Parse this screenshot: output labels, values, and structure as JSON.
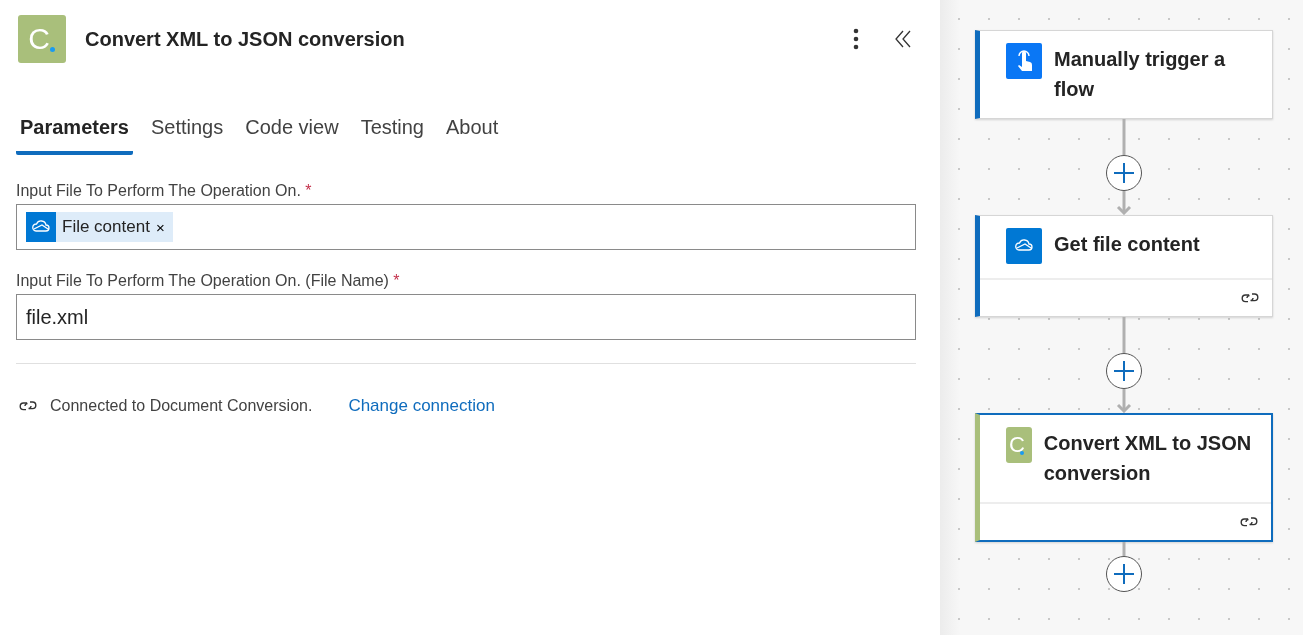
{
  "panel": {
    "logo_letter": "C",
    "title": "Convert XML to JSON conversion",
    "tabs": [
      {
        "label": "Parameters",
        "selected": true
      },
      {
        "label": "Settings",
        "selected": false
      },
      {
        "label": "Code view",
        "selected": false
      },
      {
        "label": "Testing",
        "selected": false
      },
      {
        "label": "About",
        "selected": false
      }
    ],
    "fields": [
      {
        "kind": "token",
        "label": "Input File To Perform The Operation On.",
        "required_mark": "*",
        "token": "File content",
        "token_remove": "×"
      },
      {
        "kind": "text",
        "label": "Input File To Perform The Operation On. (File Name)",
        "required_mark": "*",
        "value": "file.xml"
      }
    ],
    "connection": {
      "text": "Connected to Document Conversion.",
      "link": "Change connection"
    }
  },
  "canvas": {
    "nodes": [
      {
        "kind": "touch",
        "title": "Manually trigger a flow",
        "color": "#0f6cbd",
        "selected": false,
        "has_connection": false
      },
      {
        "kind": "cloud",
        "title": "Get file content",
        "color": "#0f6cbd",
        "selected": false,
        "has_connection": true
      },
      {
        "kind": "logo",
        "logo_letter": "C",
        "title": "Convert XML to JSON conversion",
        "color": "#a9bf7b",
        "selected": true,
        "has_connection": true
      }
    ]
  }
}
